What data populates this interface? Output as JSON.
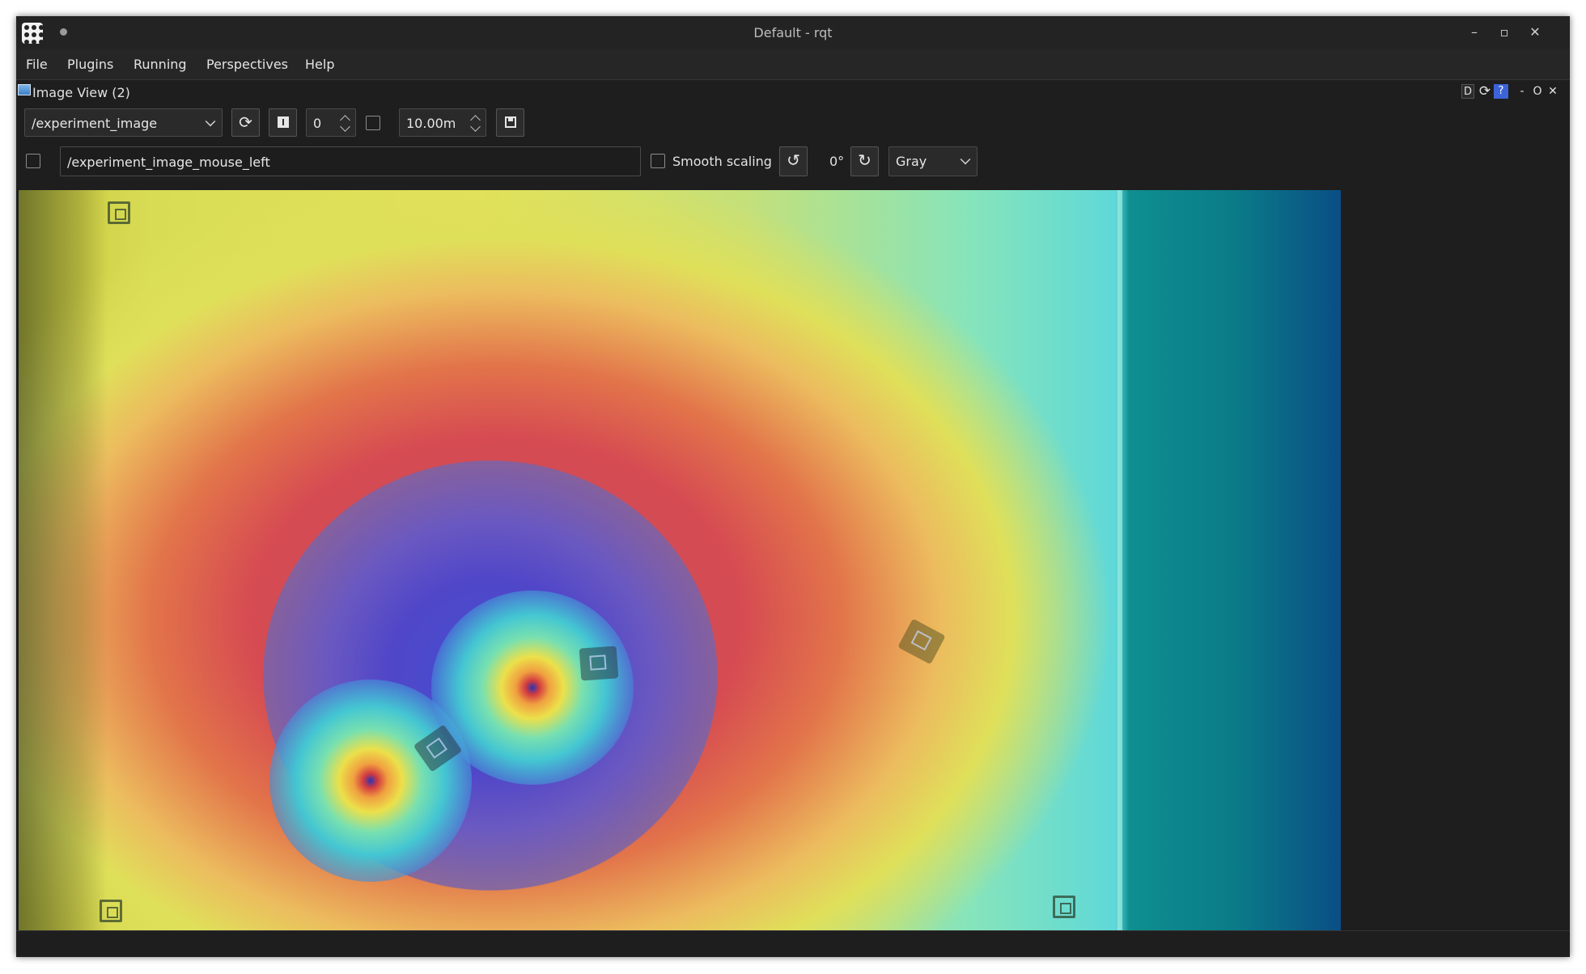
{
  "window": {
    "title": "Default - rqt"
  },
  "menubar": {
    "items": [
      "File",
      "Plugins",
      "Running",
      "Perspectives",
      "Help"
    ]
  },
  "dock": {
    "title": "Image View (2)",
    "d_label": "D",
    "help_label": "?",
    "minimize_label": "-",
    "float_label": "O",
    "close_label": "✕"
  },
  "toolbar": {
    "topic": "/experiment_image",
    "frame_number": "0",
    "duration": "10.00m",
    "mouse_topic": "/experiment_image_mouse_left",
    "smooth_scaling_label": "Smooth scaling",
    "smooth_scaling_checked": false,
    "rotation": "0°",
    "colormap": "Gray"
  },
  "icons": {
    "refresh": "refresh-icon",
    "pause": "pause-icon",
    "save": "save-icon",
    "rotate_left": "rotate-left-icon",
    "rotate_right": "rotate-right-icon"
  },
  "colors": {
    "window_bg": "#1e1e1e",
    "accent_help": "#3d63d8"
  }
}
